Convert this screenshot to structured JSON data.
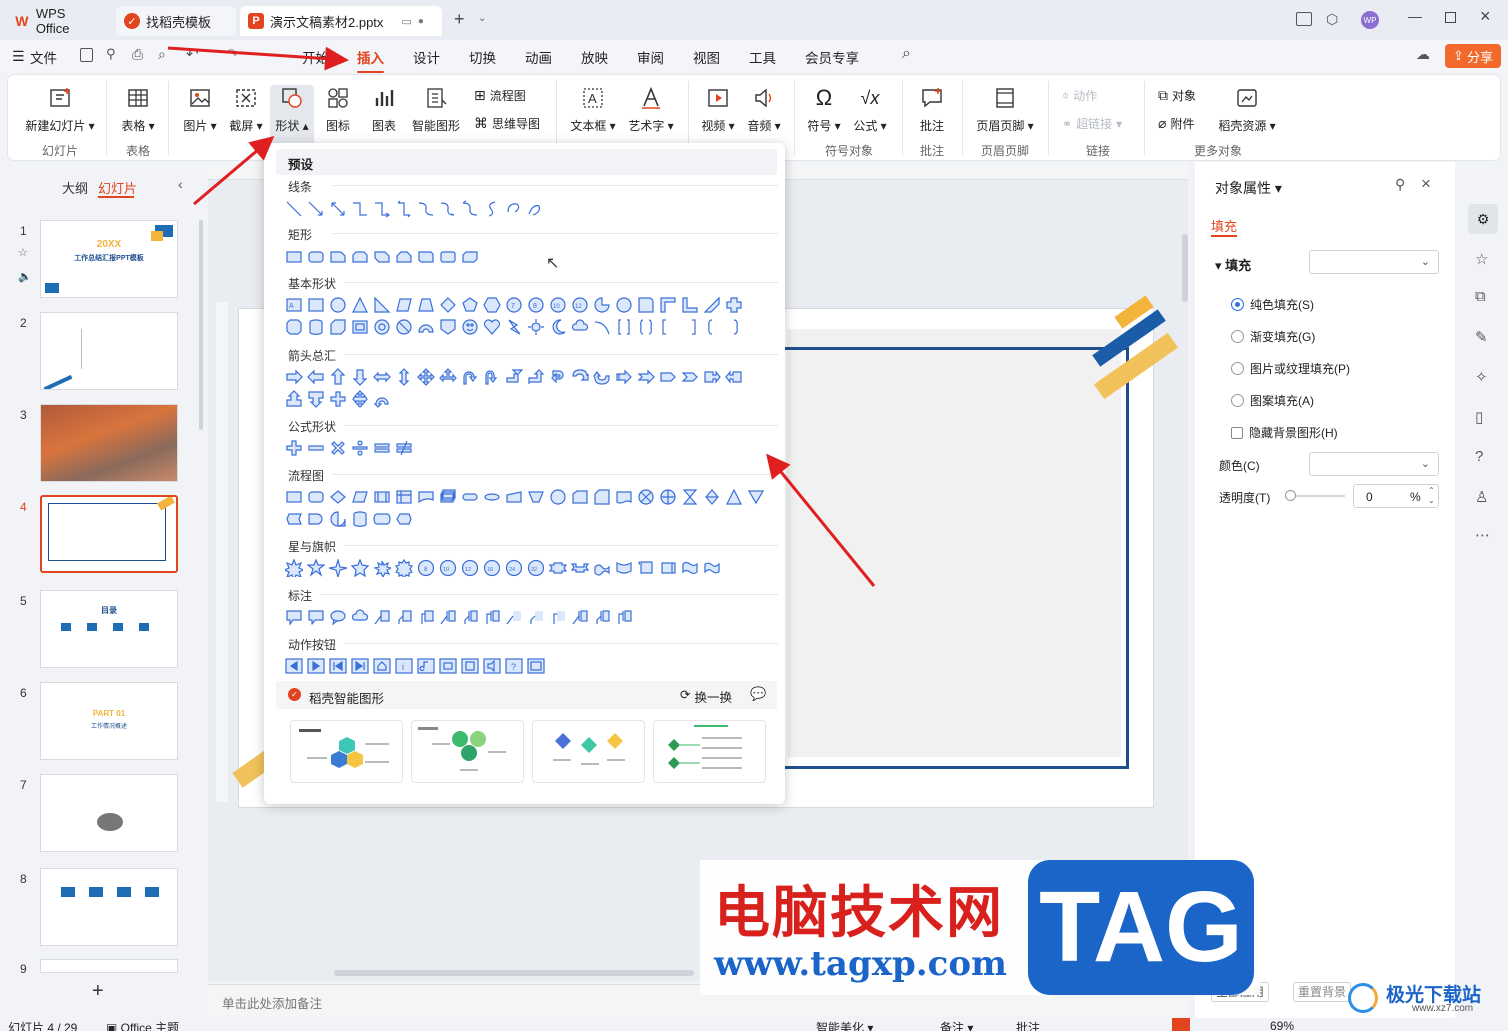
{
  "tabs": [
    {
      "label": "WPS Office"
    },
    {
      "label": "找稻壳模板"
    },
    {
      "label": "演示文稿素材2.pptx"
    }
  ],
  "menu": {
    "file": "文件",
    "items": [
      "开始",
      "插入",
      "设计",
      "切换",
      "动画",
      "放映",
      "审阅",
      "视图",
      "工具",
      "会员专享"
    ],
    "share": "分享"
  },
  "ribbon": {
    "new_slide": "新建幻灯片",
    "table": "表格",
    "picture": "图片",
    "screenshot": "截屏",
    "shape": "形状",
    "icon": "图标",
    "chart": "图表",
    "smart_graphic": "智能图形",
    "flowchart": "流程图",
    "mindmap": "思维导图",
    "textbox": "文本框",
    "wordart": "艺术字",
    "video": "视频",
    "audio": "音频",
    "symbol": "符号",
    "formula": "公式",
    "comment": "批注",
    "header_footer": "页眉页脚",
    "action": "动作",
    "hyperlink": "超链接",
    "object": "对象",
    "attachment": "附件",
    "daoke": "稻壳资源",
    "groups": [
      "幻灯片",
      "表格",
      "符号对象",
      "批注",
      "页眉页脚",
      "链接",
      "更多对象"
    ]
  },
  "left": {
    "outline": "大纲",
    "slides": "幻灯片",
    "numbers": [
      "1",
      "2",
      "3",
      "4",
      "5",
      "6",
      "7",
      "8",
      "9"
    ],
    "s1_year": "20XX",
    "s1_title": "工作总结汇报PPT模板",
    "s5_title": "目录",
    "s6_part": "PART 01",
    "s6_sub": "工作情况概述",
    "add": "+"
  },
  "shapes_popup": {
    "preset": "预设",
    "lines": "线条",
    "rect": "矩形",
    "basic": "基本形状",
    "arrows": "箭头总汇",
    "formula": "公式形状",
    "flow": "流程图",
    "stars": "星与旗帜",
    "callouts": "标注",
    "action_btns": "动作按钮",
    "smart": "稻壳智能图形",
    "refresh": "换一换"
  },
  "canvas": {
    "note_placeholder": "单击此处添加备注"
  },
  "right": {
    "title": "对象属性",
    "fill_tab": "填充",
    "fill_label": "填充",
    "options": [
      "纯色填充(S)",
      "渐变填充(G)",
      "图片或纹理填充(P)",
      "图案填充(A)"
    ],
    "hide_bg": "隐藏背景图形(H)",
    "color": "颜色(C)",
    "transparency": "透明度(T)",
    "trans_value": "0",
    "pct": "%",
    "apply_all": "全部应用",
    "reset_bg": "重置背景"
  },
  "status": {
    "slide_count": "幻灯片 4 / 29",
    "theme": "Office 主题",
    "beautify": "智能美化",
    "notes": "备注",
    "comment": "批注",
    "zoom": "69%"
  },
  "watermark": {
    "cn": "电脑技术网",
    "tag": "TAG",
    "url": "www.tagxp.com",
    "site": "极光下载站",
    "site_url": "www.xz7.com"
  }
}
